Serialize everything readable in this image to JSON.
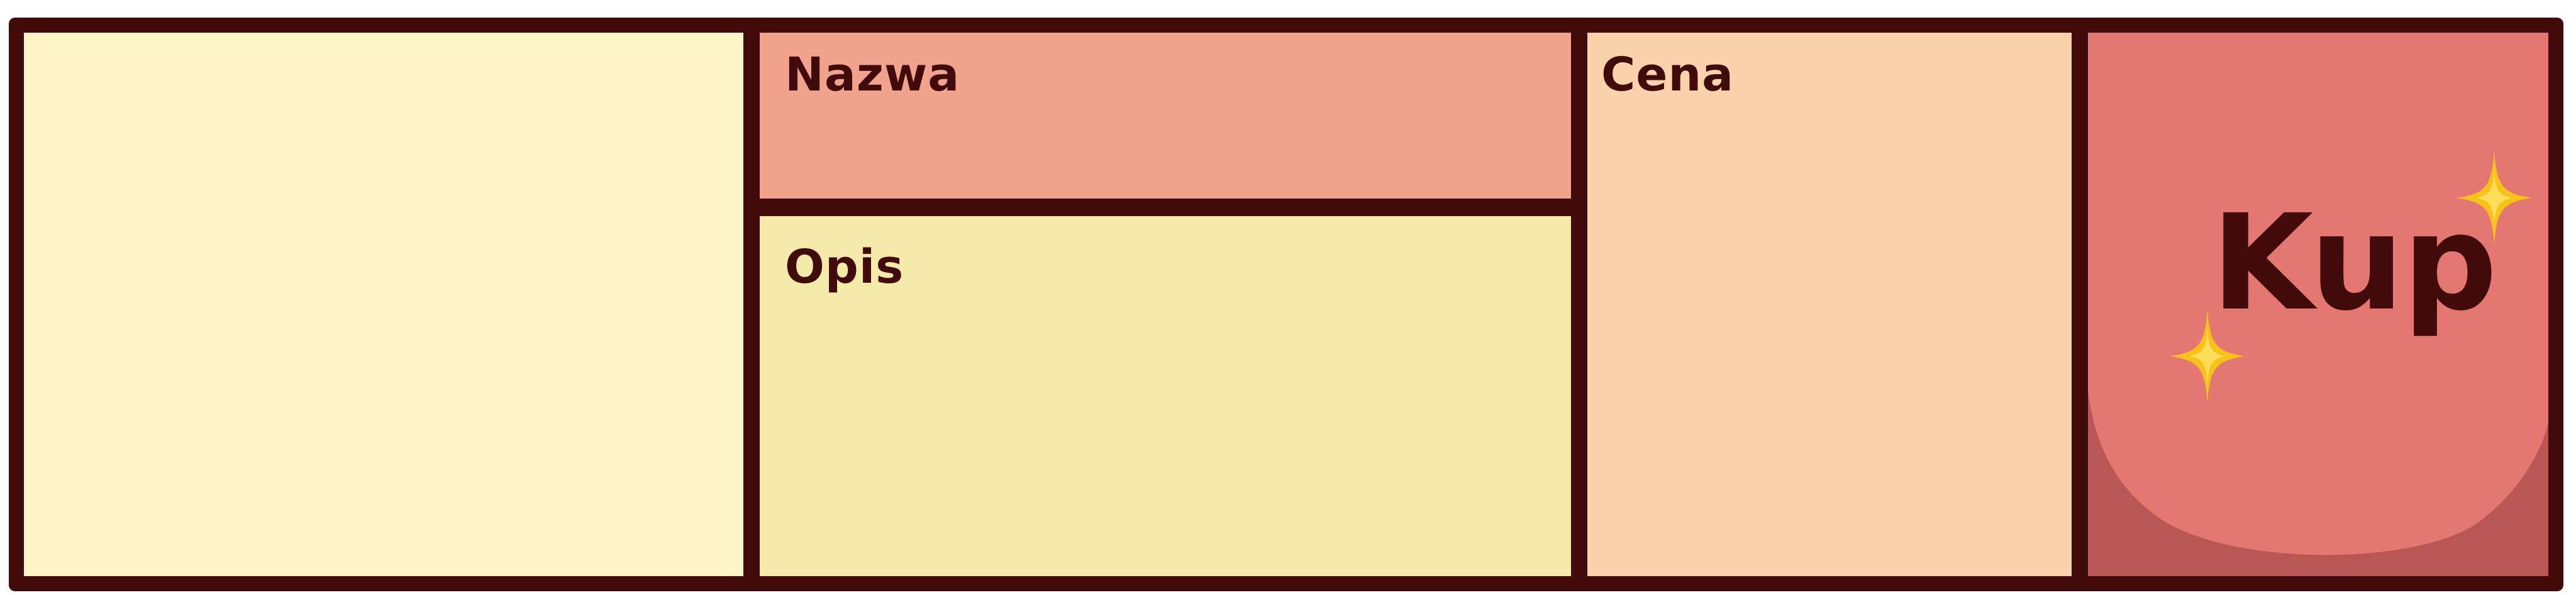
{
  "colors": {
    "outline": "#420b0b",
    "image_cell": "#fcf4c6",
    "name_cell": "#f2a38d",
    "description_cell": "#f5eaa9",
    "price_cell": "#fad3ac",
    "buy_cell": "#e57772",
    "buy_shadow": "#b95754",
    "sparkle": "#f7c21a"
  },
  "product_card": {
    "image_slot": "",
    "name_label": "Nazwa",
    "description_label": "Opis",
    "price_label": "Cena",
    "buy_button": {
      "label": "Kup",
      "icon": "sparkle-icon"
    }
  }
}
